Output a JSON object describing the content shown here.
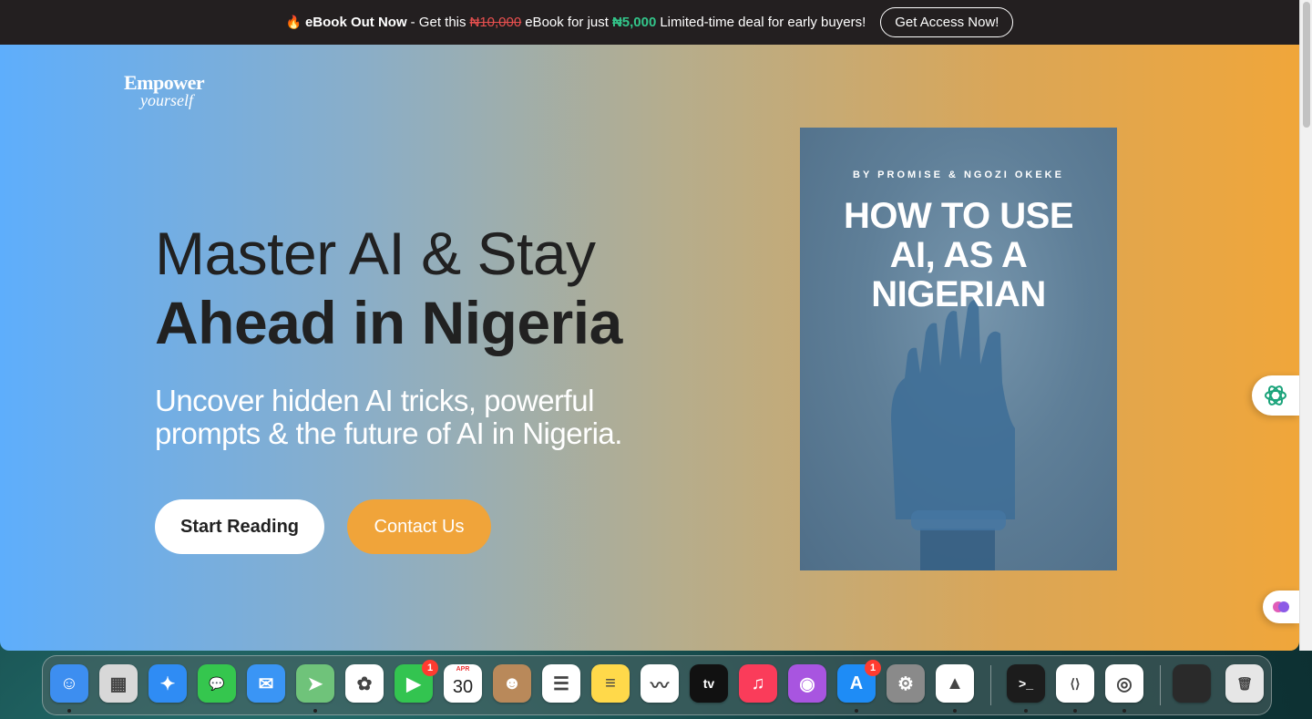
{
  "promo": {
    "fire_icon": "🔥",
    "title": "eBook Out Now",
    "text1": " - Get this ",
    "old_price": "₦10,000",
    "text2": " eBook for just ",
    "new_price": "₦5,000",
    "text3": " Limited-time deal for early buyers!",
    "button": "Get Access Now!"
  },
  "logo": {
    "line1": "Empower",
    "line2": "yourself"
  },
  "hero": {
    "line1": "Master AI & Stay",
    "line2": "Ahead in Nigeria",
    "subtitle": "Uncover hidden AI tricks, powerful prompts & the future of AI in Nigeria.",
    "start_button": "Start Reading",
    "contact_button": "Contact Us"
  },
  "book": {
    "byline": "BY PROMISE & NGOZI OKEKE",
    "title_line1": "HOW TO USE",
    "title_line2": "AI, AS A",
    "title_line3": "NIGERIAN"
  },
  "widgets": {
    "chat_icon": "openai-icon",
    "brain_icon": "brain-icon"
  },
  "dock": {
    "apps": [
      {
        "name": "finder-icon",
        "color": "#3d8ef0",
        "glyph": "☺"
      },
      {
        "name": "launchpad-icon",
        "color": "#d8d8d8",
        "glyph": "▦"
      },
      {
        "name": "safari-icon",
        "color": "#2f8cf4",
        "glyph": "✦"
      },
      {
        "name": "messages-icon",
        "color": "#35c64e",
        "glyph": "💬"
      },
      {
        "name": "mail-icon",
        "color": "#3a95f5",
        "glyph": "✉"
      },
      {
        "name": "maps-icon",
        "color": "#6fc37a",
        "glyph": "➤"
      },
      {
        "name": "photos-icon",
        "color": "#ffffff",
        "glyph": "✿"
      },
      {
        "name": "facetime-icon",
        "color": "#33c450",
        "glyph": "▶",
        "badge": "1"
      },
      {
        "name": "calendar-icon",
        "color": "#ffffff",
        "glyph": "30",
        "sub": "APR"
      },
      {
        "name": "contacts-icon",
        "color": "#b9895a",
        "glyph": "☻"
      },
      {
        "name": "reminders-icon",
        "color": "#ffffff",
        "glyph": "☰"
      },
      {
        "name": "notes-icon",
        "color": "#ffd94a",
        "glyph": "≡"
      },
      {
        "name": "freeform-icon",
        "color": "#ffffff",
        "glyph": "〰"
      },
      {
        "name": "apple-tv-icon",
        "color": "#111111",
        "glyph": "tv"
      },
      {
        "name": "music-icon",
        "color": "#fa3c5a",
        "glyph": "♫"
      },
      {
        "name": "podcasts-icon",
        "color": "#a855e0",
        "glyph": "◉"
      },
      {
        "name": "app-store-icon",
        "color": "#1e8cf6",
        "glyph": "A",
        "badge": "1"
      },
      {
        "name": "system-settings-icon",
        "color": "#8a8a8a",
        "glyph": "⚙"
      },
      {
        "name": "vlc-icon",
        "color": "#ffffff",
        "glyph": "▲"
      },
      {
        "name": "terminal-icon",
        "color": "#1c1c1c",
        "glyph": ">_"
      },
      {
        "name": "vscode-icon",
        "color": "#ffffff",
        "glyph": "⟨⟩"
      },
      {
        "name": "chrome-icon",
        "color": "#ffffff",
        "glyph": "◎"
      },
      {
        "name": "screenshot-thumb-icon",
        "color": "#2a2a2a",
        "glyph": ""
      },
      {
        "name": "trash-icon",
        "color": "#e6e6e6",
        "glyph": "🗑"
      }
    ]
  }
}
